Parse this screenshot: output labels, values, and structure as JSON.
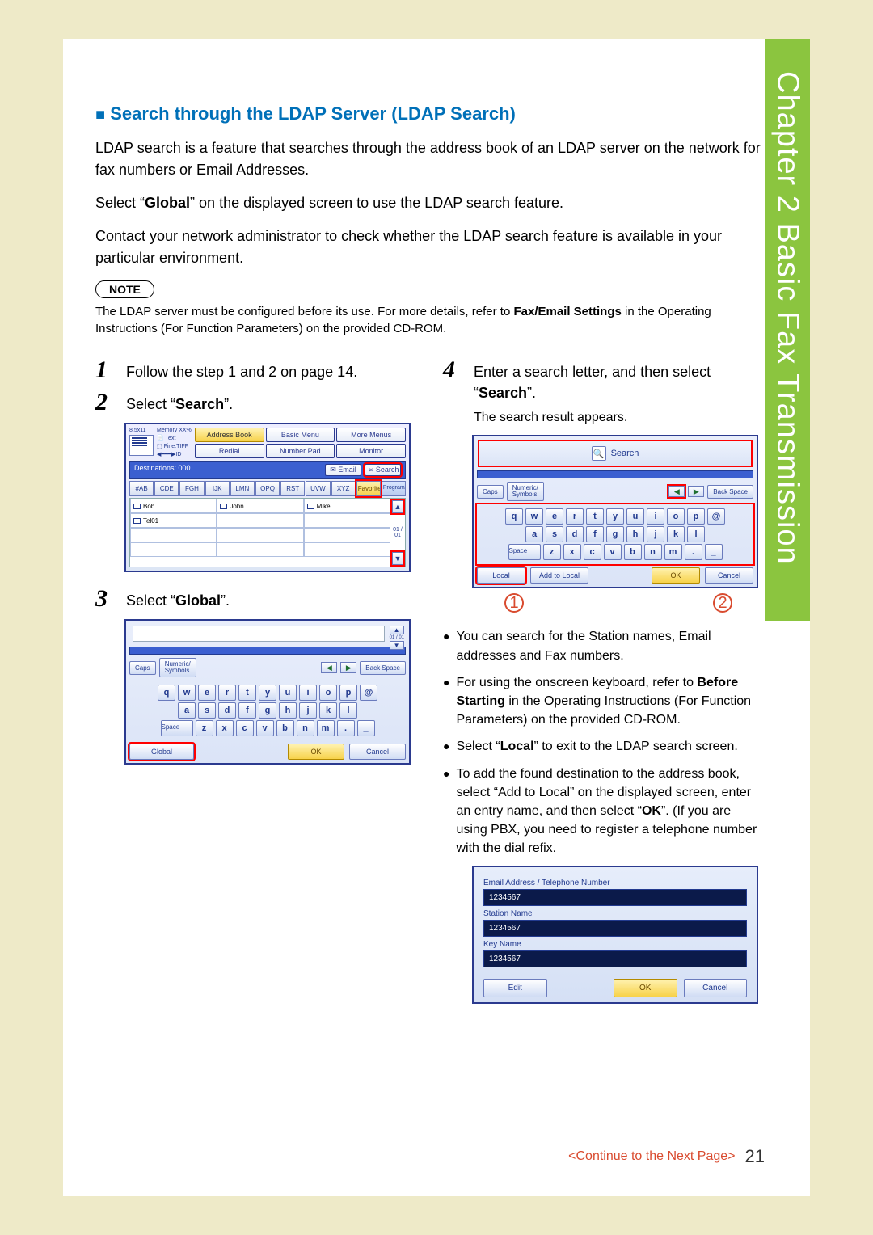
{
  "side_tab": "Chapter 2    Basic Fax Transmission",
  "section": {
    "title": "Search through the LDAP Server (LDAP Search)",
    "p1": "LDAP search is a feature that searches through the address book of an LDAP server on the network for fax numbers or Email Addresses.",
    "p2_a": "Select “",
    "p2_b": "Global",
    "p2_c": "” on the displayed screen to use the LDAP search feature.",
    "p3": "Contact your network administrator to check whether the LDAP search feature is available in your particular environment."
  },
  "note": {
    "badge": "NOTE",
    "text_a": "The LDAP server must be configured before its use. For more details, refer to ",
    "text_b": "Fax/Email Settings",
    "text_c": " in the Operating Instructions (For Function Parameters) on the provided CD-ROM."
  },
  "steps_left": {
    "s1": "Follow the step 1 and 2 on page 14.",
    "s2_a": "Select “",
    "s2_b": "Search",
    "s2_c": "”.",
    "s3_a": "Select “",
    "s3_b": "Global",
    "s3_c": "”."
  },
  "steps_right": {
    "s4_a": "Enter a search letter, and then select “",
    "s4_b": "Search",
    "s4_c": "”.",
    "s4_sub": "The search result appears."
  },
  "bullets": [
    "You can search for the Station names, Email addresses and Fax numbers.",
    {
      "pre": "For using the onscreen keyboard, refer to ",
      "bold": "Before Starting",
      "post": " in the Operating Instructions (For Function Parameters) on the provided CD-ROM."
    },
    {
      "pre": "Select “",
      "bold": "Local",
      "post": "” to exit to the LDAP search screen."
    },
    {
      "pre": "To add the found destination to the address book, select “Add to Local” on the displayed screen, enter an entry name, and then select “",
      "bold": "OK",
      "post": "”. (If you are using PBX, you need to register a telephone number with the dial refix."
    }
  ],
  "shot1": {
    "hdr_left": "8.5x11",
    "hdr_mem": "Memory XX%",
    "hdr_text": "Text",
    "hdr_fine": "Fine.TIFF",
    "btn_addr": "Address Book",
    "btn_basic": "Basic Menu",
    "btn_more": "More Menus",
    "btn_redial": "Redial",
    "btn_numpad": "Number Pad",
    "btn_monitor": "Monitor",
    "dest": "Destinations: 000",
    "email": "Email",
    "search": "Search",
    "tabs": [
      "#AB",
      "CDE",
      "FGH",
      "IJK",
      "LMN",
      "OPQ",
      "RST",
      "UVW",
      "XYZ",
      "Favorites",
      "Program/Group"
    ],
    "names": [
      "Bob",
      "John",
      "Mike",
      "Tel01"
    ],
    "page": "01 / 01"
  },
  "kbd": {
    "caps": "Caps",
    "numsym": "Numeric/\nSymbols",
    "backspace": "Back Space",
    "space": "Space",
    "row1": [
      "q",
      "w",
      "e",
      "r",
      "t",
      "y",
      "u",
      "i",
      "o",
      "p",
      "@"
    ],
    "row2": [
      "a",
      "s",
      "d",
      "f",
      "g",
      "h",
      "j",
      "k",
      "l"
    ],
    "row3": [
      "z",
      "x",
      "c",
      "v",
      "b",
      "n",
      "m",
      ".",
      "_"
    ]
  },
  "shot2": {
    "global": "Global",
    "ok": "OK",
    "cancel": "Cancel",
    "page": "01 / 01"
  },
  "shot3": {
    "search_label": "Search",
    "local": "Local",
    "add_local": "Add to Local",
    "ok": "OK",
    "cancel": "Cancel",
    "callout1": "1",
    "callout2": "2"
  },
  "shot4": {
    "label1": "Email Address / Telephone Number",
    "val1": "1234567",
    "label2": "Station Name",
    "val2": "1234567",
    "label3": "Key Name",
    "val3": "1234567",
    "edit": "Edit",
    "ok": "OK",
    "cancel": "Cancel"
  },
  "footer": {
    "continue": "<Continue to the Next Page>",
    "page": "21"
  }
}
